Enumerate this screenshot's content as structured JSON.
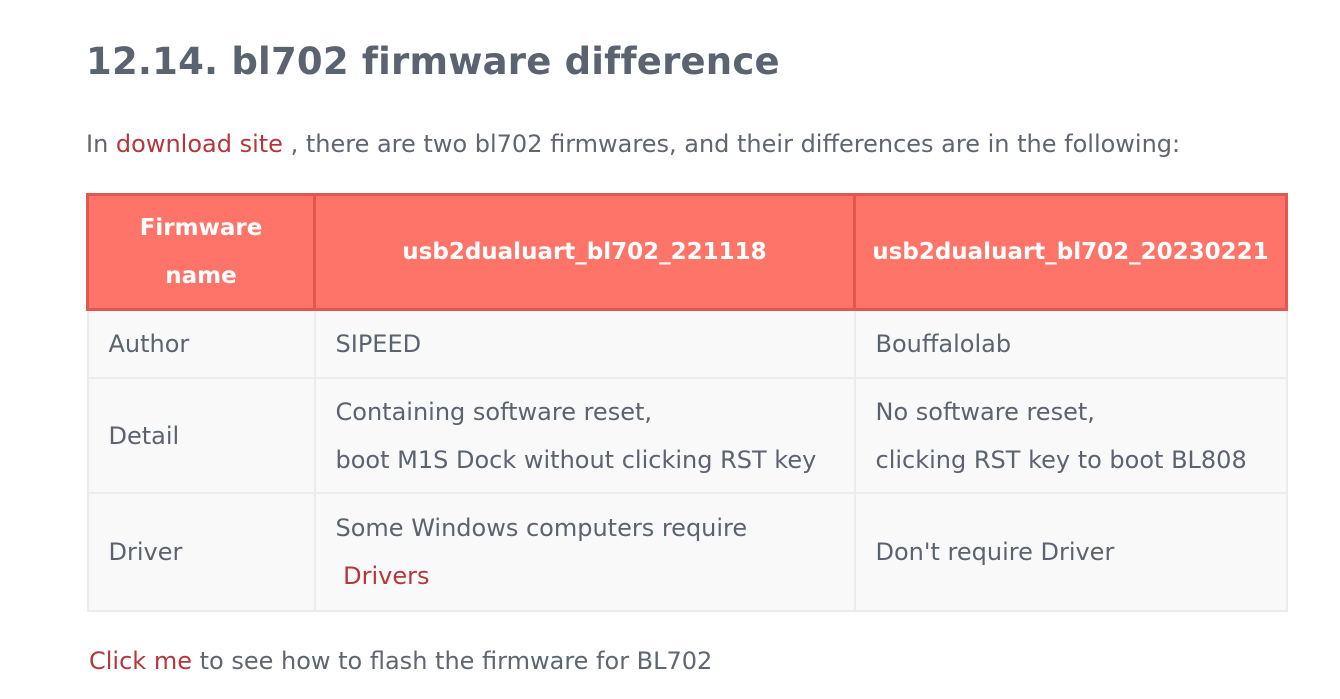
{
  "heading": "12.14. bl702 firmware difference",
  "intro": {
    "before": "In ",
    "link": "download site",
    "after": " ,  there are two bl702 firmwares, and their differences are in the following:"
  },
  "table": {
    "headers": {
      "col1_line1": "Firmware",
      "col1_line2": "name",
      "col2": "usb2dualuart_bl702_221118",
      "col3": "usb2dualuart_bl702_20230221"
    },
    "rows": [
      {
        "label": "Author",
        "fw1": "SIPEED",
        "fw2": "Bouffalolab"
      },
      {
        "label": "Detail",
        "fw1_line1": "Containing software reset,",
        "fw1_line2": "boot M1S Dock without clicking RST key",
        "fw2_line1": "No software reset,",
        "fw2_line2": "clicking RST key to boot BL808"
      },
      {
        "label": "Driver",
        "fw1_line1": "Some Windows computers require",
        "fw1_link": "Drivers",
        "fw2": "Don't require Driver"
      }
    ]
  },
  "outro": {
    "link": "Click me",
    "after": "  to see how to flash the firmware for BL702"
  },
  "colors": {
    "header_bg": "#ff7468",
    "header_border": "#e45750",
    "link": "#b5373b",
    "text": "#5b6370",
    "cell_bg": "#f9f9f9"
  }
}
